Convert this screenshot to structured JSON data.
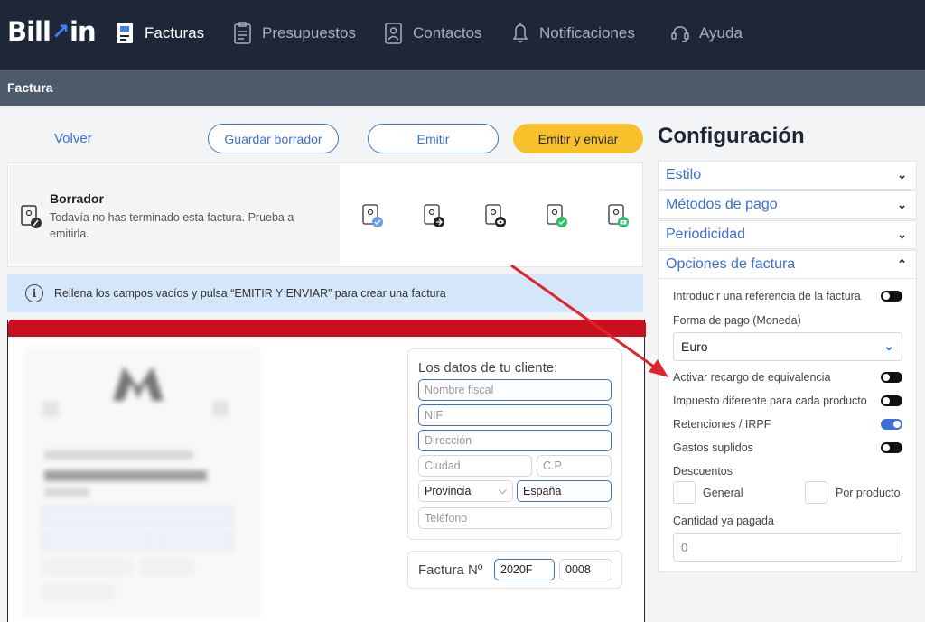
{
  "brand": {
    "logo_text_1": "Bill",
    "logo_arrow": "↗",
    "logo_text_2": "in"
  },
  "nav": {
    "items": [
      {
        "label": "Facturas",
        "icon": "invoice-icon"
      },
      {
        "label": "Presupuestos",
        "icon": "quote-icon"
      },
      {
        "label": "Contactos",
        "icon": "contacts-icon"
      },
      {
        "label": "Notificaciones",
        "icon": "bell-icon"
      },
      {
        "label": "Ayuda",
        "icon": "help-icon"
      }
    ]
  },
  "subheader": {
    "title": "Factura"
  },
  "actions": {
    "back": "Volver",
    "save_draft": "Guardar borrador",
    "emit": "Emitir",
    "emit_send": "Emitir y enviar"
  },
  "status": {
    "title": "Borrador",
    "description": "Todavía no has terminado esta factura. Prueba a emitirla."
  },
  "info": {
    "text": "Rellena los campos vacíos y pulsa “EMITIR Y ENVIAR” para crear una factura"
  },
  "client": {
    "title": "Los datos de tu cliente:",
    "placeholders": {
      "fiscal_name": "Nombre fiscal",
      "nif": "NIF",
      "address": "Dirección",
      "city": "Ciudad",
      "zip": "C.P.",
      "province": "Provincia",
      "phone": "Teléfono"
    },
    "country": "España"
  },
  "invoice_number": {
    "label": "Factura Nº",
    "series": "2020F",
    "number": "0008"
  },
  "config": {
    "title": "Configuración",
    "sections": {
      "style": "Estilo",
      "payment_methods": "Métodos de pago",
      "periodicity": "Periodicidad",
      "invoice_options": "Opciones de factura"
    },
    "options": {
      "reference": "Introducir una referencia de la factura",
      "payment_form_label": "Forma de pago (Moneda)",
      "currency": "Euro",
      "surcharge": "Activar recargo de equivalencia",
      "tax_per_product": "Impuesto diferente para cada producto",
      "retentions": "Retenciones / IRPF",
      "expenses": "Gastos suplidos",
      "discounts_label": "Descuentos",
      "discount_general": "General",
      "discount_per_product": "Por producto",
      "paid_label": "Cantidad ya pagada",
      "paid_value": "0"
    },
    "toggles": {
      "reference": false,
      "surcharge": false,
      "tax_per_product": false,
      "retentions": true,
      "expenses": false
    }
  },
  "colors": {
    "navbar": "#1d2737",
    "accent": "#3d6fd6",
    "primary_button": "#f8c12b",
    "invoice_header": "#c8101e",
    "annotation_arrow": "#e0242b"
  }
}
